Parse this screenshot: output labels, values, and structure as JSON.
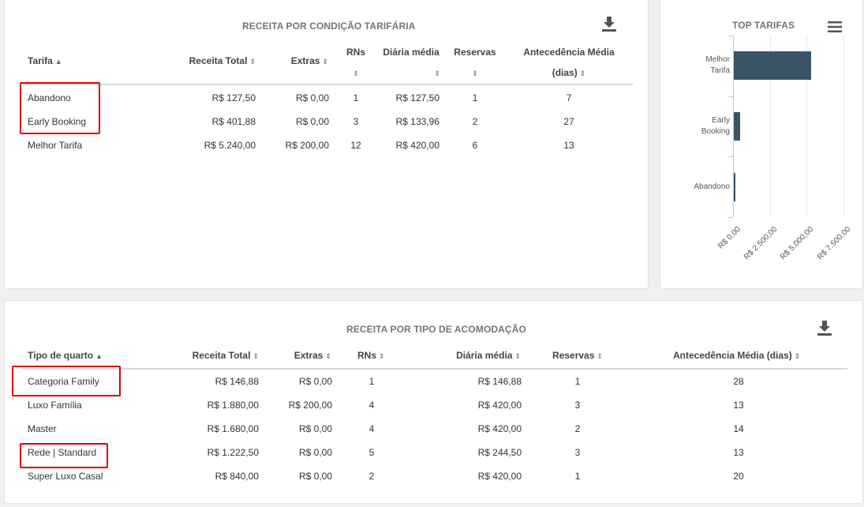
{
  "tarifa_table": {
    "title": "RECEITA POR CONDIÇÃO TARIFÁRIA",
    "headers": {
      "tarifa": "Tarifa",
      "receita_total": "Receita Total",
      "extras": "Extras",
      "rns": "RNs",
      "diaria_media": "Diária média",
      "reservas": "Reservas",
      "antecedencia_1": "Antecedência Média",
      "antecedencia_2": "(dias)"
    },
    "rows": [
      {
        "tarifa": "Abandono",
        "receita": "R$ 127,50",
        "extras": "R$ 0,00",
        "rns": "1",
        "diaria": "R$ 127,50",
        "reservas": "1",
        "antecedencia": "7"
      },
      {
        "tarifa": "Early Booking",
        "receita": "R$ 401,88",
        "extras": "R$ 0,00",
        "rns": "3",
        "diaria": "R$ 133,96",
        "reservas": "2",
        "antecedencia": "27"
      },
      {
        "tarifa": "Melhor Tarifa",
        "receita": "R$ 5.240,00",
        "extras": "R$ 200,00",
        "rns": "12",
        "diaria": "R$ 420,00",
        "reservas": "6",
        "antecedencia": "13"
      }
    ]
  },
  "top_tarifas": {
    "title": "TOP TARIFAS"
  },
  "chart_data": {
    "type": "bar",
    "orientation": "horizontal",
    "title": "TOP TARIFAS",
    "categories": [
      "Melhor Tarifa",
      "Early Booking",
      "Abandono"
    ],
    "category_lines": [
      [
        "Melhor",
        "Tarifa"
      ],
      [
        "Early",
        "Booking"
      ],
      [
        "Abandono"
      ]
    ],
    "values": [
      5240.0,
      401.88,
      127.5
    ],
    "xlim": [
      0,
      7500
    ],
    "xticks": [
      0,
      2500,
      5000,
      7500
    ],
    "xtick_labels": [
      "R$ 0,00",
      "R$ 2.500,00",
      "R$ 5.000,00",
      "R$ 7.500,00"
    ],
    "grid": true,
    "color": "#3a5566"
  },
  "acomod_table": {
    "title": "RECEITA POR TIPO DE ACOMODAÇÃO",
    "headers": {
      "tipo": "Tipo de quarto",
      "receita_total": "Receita Total",
      "extras": "Extras",
      "rns": "RNs",
      "diaria_media": "Diária média",
      "reservas": "Reservas",
      "antecedencia": "Antecedência Média (dias)"
    },
    "rows": [
      {
        "tipo": "Categoria Family",
        "receita": "R$ 146,88",
        "extras": "R$ 0,00",
        "rns": "1",
        "diaria": "R$ 146,88",
        "reservas": "1",
        "antecedencia": "28"
      },
      {
        "tipo": "Luxo Família",
        "receita": "R$ 1.880,00",
        "extras": "R$ 200,00",
        "rns": "4",
        "diaria": "R$ 420,00",
        "reservas": "3",
        "antecedencia": "13"
      },
      {
        "tipo": "Master",
        "receita": "R$ 1.680,00",
        "extras": "R$ 0,00",
        "rns": "4",
        "diaria": "R$ 420,00",
        "reservas": "2",
        "antecedencia": "14"
      },
      {
        "tipo": "Rede | Standard",
        "receita": "R$ 1.222,50",
        "extras": "R$ 0,00",
        "rns": "5",
        "diaria": "R$ 244,50",
        "reservas": "3",
        "antecedencia": "13"
      },
      {
        "tipo": "Super Luxo Casal",
        "receita": "R$ 840,00",
        "extras": "R$ 0,00",
        "rns": "2",
        "diaria": "R$ 420,00",
        "reservas": "1",
        "antecedencia": "20"
      }
    ]
  },
  "icons": {
    "download": "download-icon",
    "menu": "hamburger-menu-icon",
    "sort": "sort-icon",
    "sort_asc": "sort-asc-icon"
  }
}
